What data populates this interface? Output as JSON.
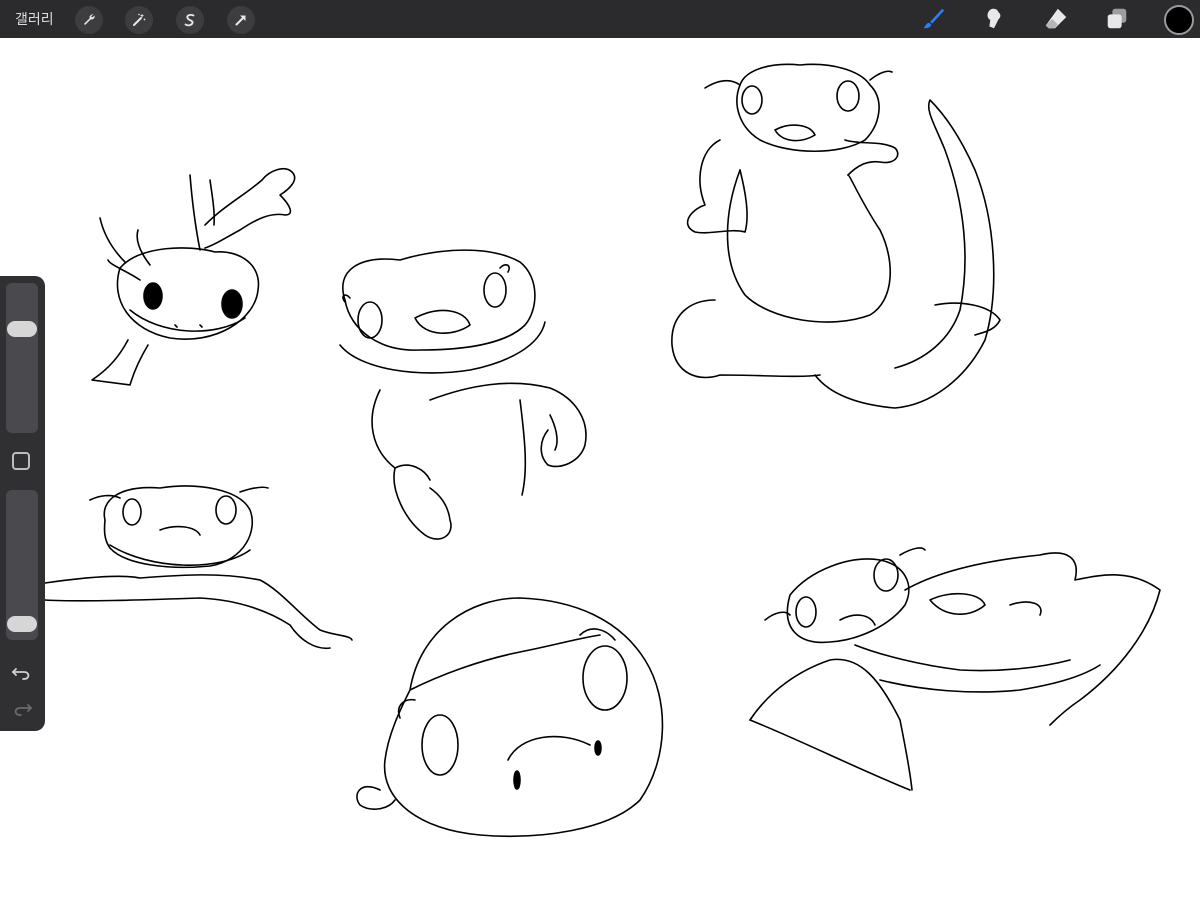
{
  "toolbar": {
    "gallery_label": "갤러리",
    "left_tools": [
      {
        "name": "actions",
        "icon": "wrench-icon"
      },
      {
        "name": "adjustments",
        "icon": "magic-wand-icon"
      },
      {
        "name": "selection",
        "icon": "selection-s-icon"
      },
      {
        "name": "transform",
        "icon": "arrow-icon"
      }
    ],
    "right_tools": [
      {
        "name": "brush",
        "icon": "brush-icon",
        "active": true
      },
      {
        "name": "smudge",
        "icon": "smudge-icon"
      },
      {
        "name": "eraser",
        "icon": "eraser-icon"
      },
      {
        "name": "layers",
        "icon": "layers-icon"
      }
    ],
    "current_color": "#000000",
    "active_color": "#2f7df6"
  },
  "sidebar": {
    "brush_size_level": 0.72,
    "opacity_level": 0.06
  },
  "canvas": {
    "background": "#ffffff",
    "content": "line-art-gecko-sketches"
  }
}
